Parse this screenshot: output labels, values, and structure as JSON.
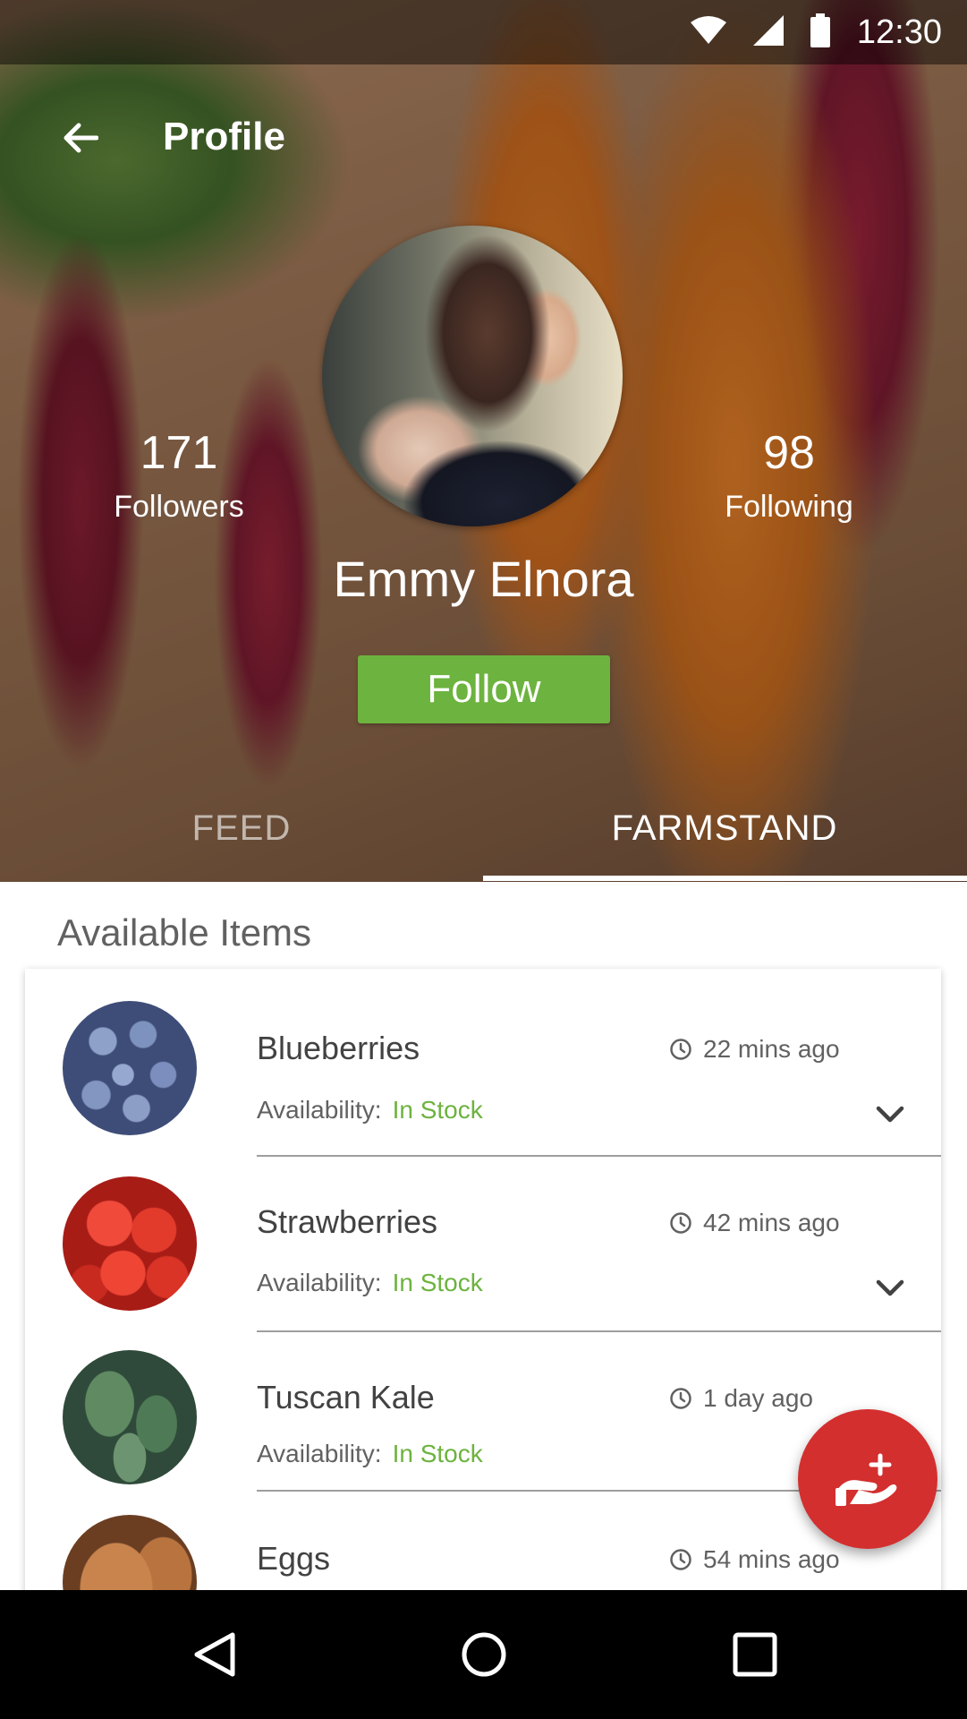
{
  "status_bar": {
    "time": "12:30"
  },
  "toolbar": {
    "title": "Profile"
  },
  "profile": {
    "name": "Emmy Elnora",
    "followers_count": "171",
    "followers_label": "Followers",
    "following_count": "98",
    "following_label": "Following",
    "follow_label": "Follow"
  },
  "tabs": [
    {
      "label": "FEED",
      "selected": false
    },
    {
      "label": "FARMSTAND",
      "selected": true
    }
  ],
  "section": {
    "title": "Available Items"
  },
  "items": [
    {
      "name": "Blueberries",
      "time": "22 mins ago",
      "availability_label": "Availability:",
      "availability": "In Stock",
      "expandable": true
    },
    {
      "name": "Strawberries",
      "time": "42 mins ago",
      "availability_label": "Availability:",
      "availability": "In Stock",
      "expandable": true
    },
    {
      "name": "Tuscan Kale",
      "time": "1 day ago",
      "availability_label": "Availability:",
      "availability": "In Stock",
      "expandable": false
    },
    {
      "name": "Eggs",
      "time": "54 mins ago"
    }
  ],
  "colors": {
    "accent_green": "#6db33f",
    "fab_red": "#d32f2f"
  },
  "icons": {
    "back": "arrow-left-icon",
    "fab": "hand-plus-icon",
    "nav": [
      "back-triangle-icon",
      "home-circle-icon",
      "recents-square-icon"
    ]
  }
}
